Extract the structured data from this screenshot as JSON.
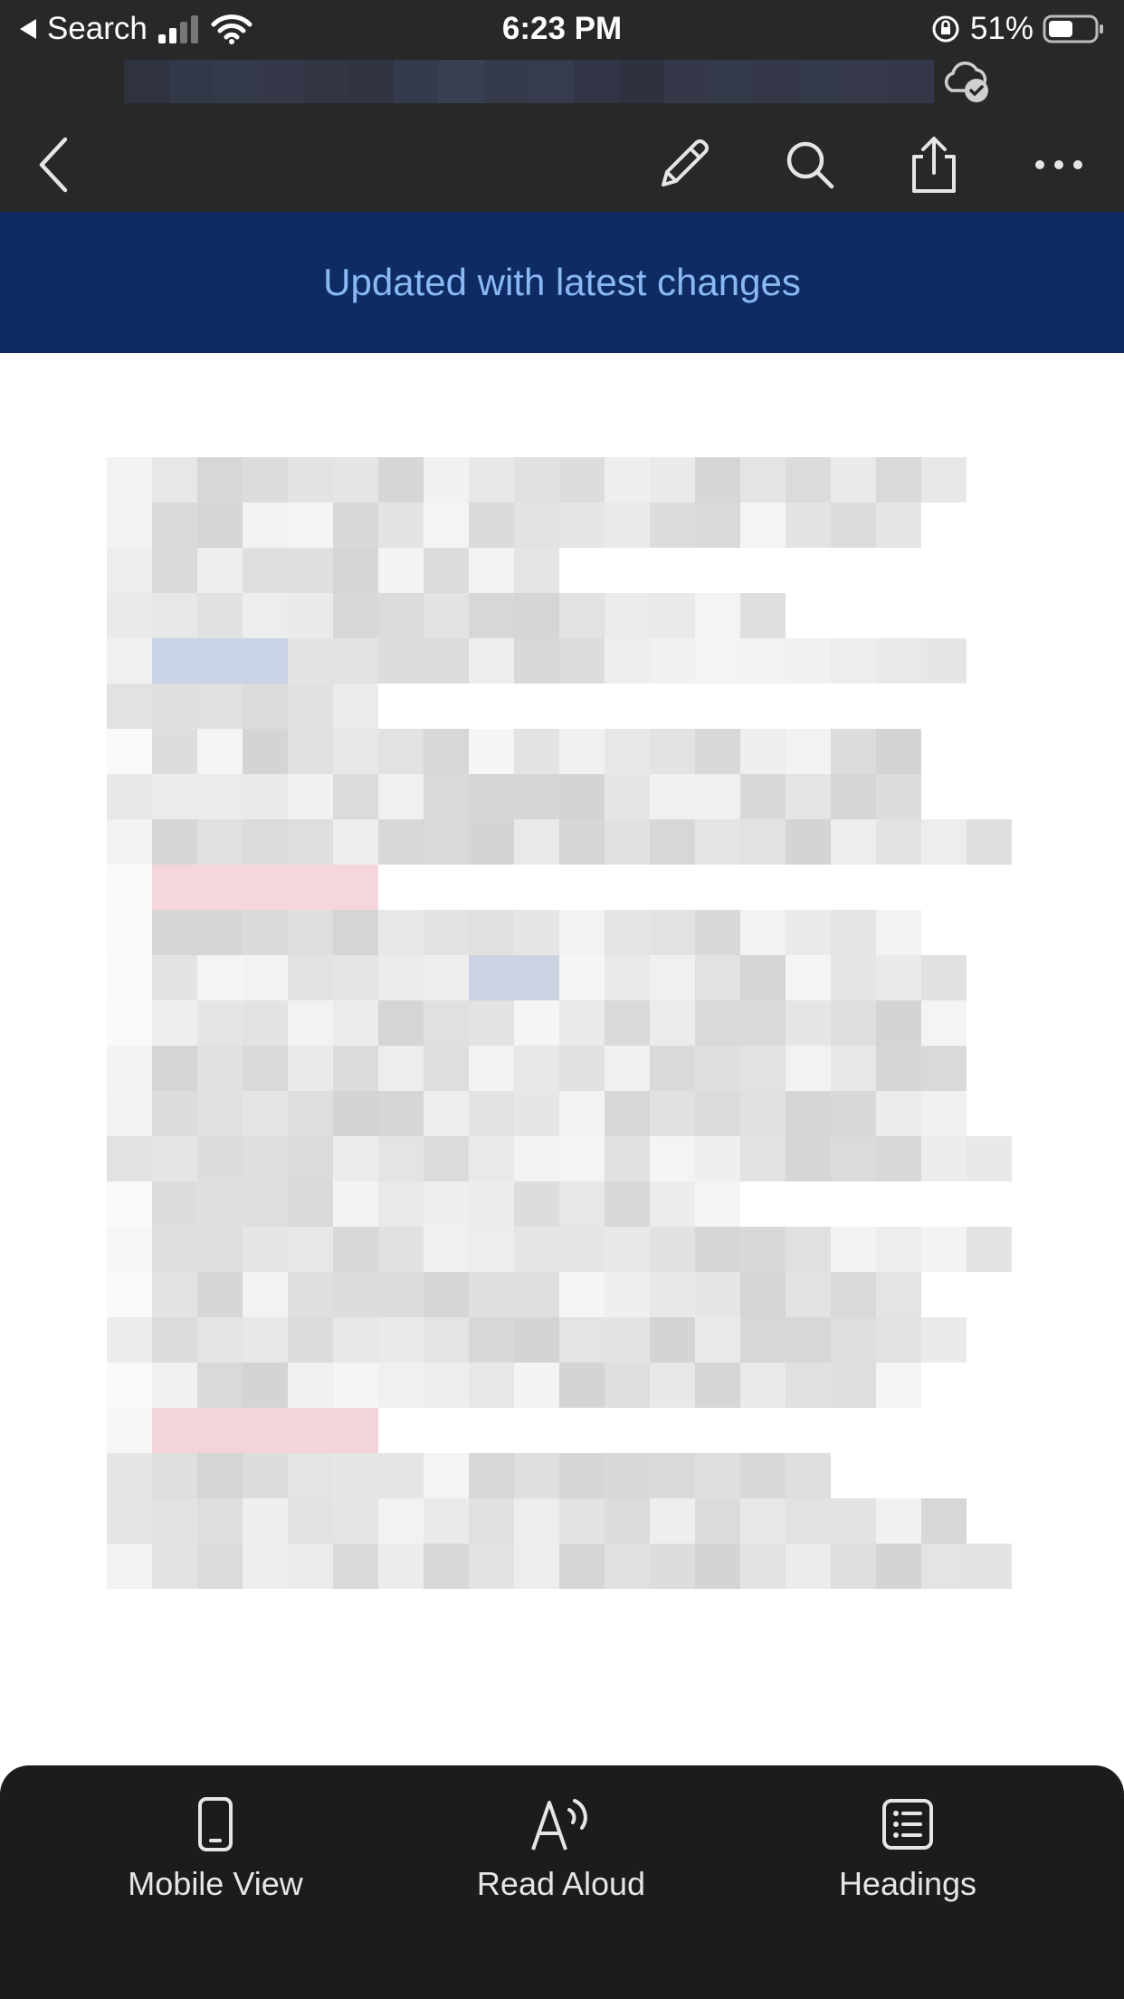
{
  "status_bar": {
    "back_app": "Search",
    "time": "6:23 PM",
    "battery": "51%"
  },
  "toolbar": {
    "back_icon": "chevron-left-icon",
    "edit_icon": "pencil-icon",
    "search_icon": "search-icon",
    "share_icon": "share-icon",
    "more_icon": "more-icon"
  },
  "banner": {
    "text": "Updated with latest changes"
  },
  "bottom_bar": {
    "items": [
      {
        "label": "Mobile View",
        "icon": "phone-icon"
      },
      {
        "label": "Read Aloud",
        "icon": "read-aloud-icon"
      },
      {
        "label": "Headings",
        "icon": "headings-icon"
      }
    ]
  },
  "colors": {
    "toolbar_bg": "#282828",
    "banner_bg": "#0e2c63",
    "banner_text": "#8ab8f3",
    "bottom_bar_bg": "#1c1c1e"
  }
}
